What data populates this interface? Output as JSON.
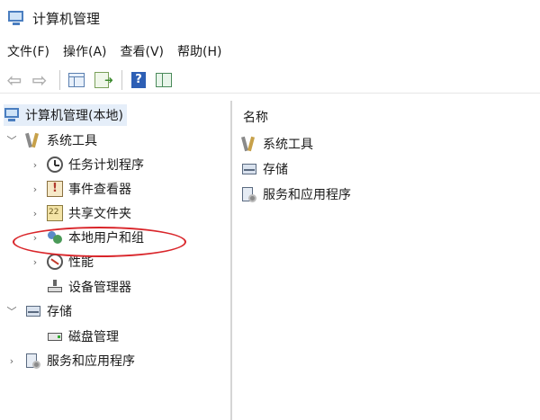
{
  "window": {
    "title": "计算机管理"
  },
  "menu": [
    "文件(F)",
    "操作(A)",
    "查看(V)",
    "帮助(H)"
  ],
  "toolbar": {
    "help_glyph": "?",
    "buttons": [
      "back-icon",
      "forward-icon",
      "console-tree-icon",
      "export-list-icon",
      "help-icon",
      "action-pane-icon"
    ]
  },
  "tree": {
    "root": "计算机管理(本地)",
    "system_tools": "系统工具",
    "task_scheduler": "任务计划程序",
    "event_viewer": "事件查看器",
    "shared_folders": "共享文件夹",
    "local_users": "本地用户和组",
    "performance": "性能",
    "device_manager": "设备管理器",
    "storage": "存储",
    "disk_management": "磁盘管理",
    "services": "服务和应用程序"
  },
  "list": {
    "header": "名称",
    "items": [
      "系统工具",
      "存储",
      "服务和应用程序"
    ]
  },
  "annotation": {
    "color": "#d9252a",
    "target": "本地用户和组"
  }
}
